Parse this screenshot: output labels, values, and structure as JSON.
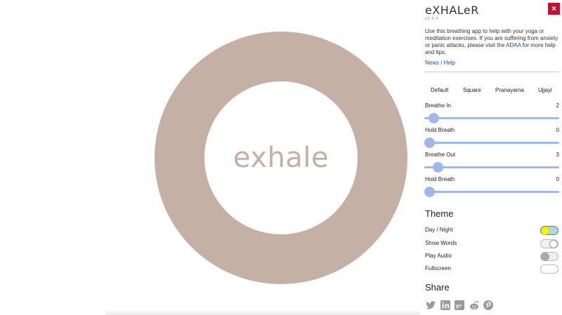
{
  "app": {
    "logo": "eXHALeR",
    "version": "v2.0.5",
    "close_label": "×"
  },
  "breath": {
    "word": "exhale",
    "ring_color": "#c4b0a5"
  },
  "intro": {
    "text_before": "Use this breathing app to help with your yoga or meditation exercises. If you are suffering from anxiety or panic attacks, please visit the ",
    "link": "ADAA",
    "text_after": " for more help and tips."
  },
  "news_link": "News / Help",
  "presets": [
    "Default",
    "Square",
    "Pranayama",
    "Ujjayi"
  ],
  "sliders": [
    {
      "label": "Breathe In",
      "value": "2"
    },
    {
      "label": "Hold Breath",
      "value": "0"
    },
    {
      "label": "Breathe Out",
      "value": "3"
    },
    {
      "label": "Hold Breath",
      "value": "0"
    }
  ],
  "theme": {
    "heading": "Theme",
    "toggles": [
      {
        "label": "Day / Night",
        "state": "day"
      },
      {
        "label": "Show Words",
        "state": "on"
      },
      {
        "label": "Play Audio",
        "state": "off"
      },
      {
        "label": "Fullscreen",
        "state": "off"
      }
    ]
  },
  "share": {
    "heading": "Share",
    "icons": [
      "twitter-icon",
      "linkedin-icon",
      "google-plus-icon",
      "reddit-icon",
      "pinterest-icon"
    ]
  },
  "colors": {
    "accent": "#9fb7ea",
    "close": "#c8102e",
    "link": "#1a4c9c",
    "day_toggle_knob": "#f5f500",
    "day_toggle_bg": "#a9d8e6"
  }
}
